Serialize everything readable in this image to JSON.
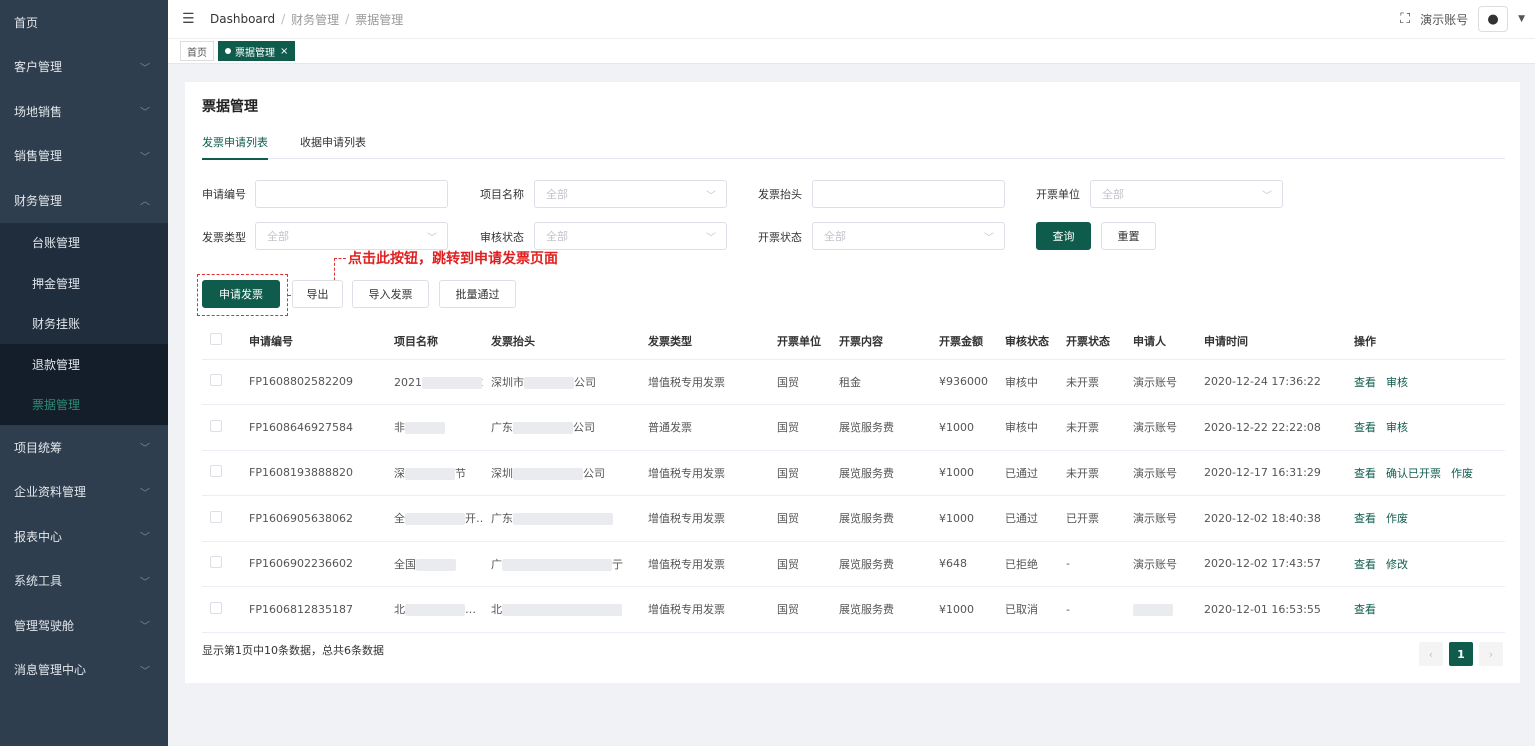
{
  "sidebar": {
    "items": [
      {
        "label": "首页",
        "chev": ""
      },
      {
        "label": "客户管理",
        "chev": "﹀"
      },
      {
        "label": "场地销售",
        "chev": "﹀"
      },
      {
        "label": "销售管理",
        "chev": "﹀"
      },
      {
        "label": "财务管理",
        "chev": "︿"
      }
    ],
    "submenu": [
      {
        "label": "台账管理"
      },
      {
        "label": "押金管理"
      },
      {
        "label": "财务挂账"
      },
      {
        "label": "退款管理"
      },
      {
        "label": "票据管理"
      }
    ],
    "items_after": [
      {
        "label": "项目统筹",
        "chev": "﹀"
      },
      {
        "label": "企业资料管理",
        "chev": "﹀"
      },
      {
        "label": "报表中心",
        "chev": "﹀"
      },
      {
        "label": "系统工具",
        "chev": "﹀"
      },
      {
        "label": "管理驾驶舱",
        "chev": "﹀"
      },
      {
        "label": "消息管理中心",
        "chev": "﹀"
      }
    ]
  },
  "header": {
    "breadcrumb": [
      "Dashboard",
      "财务管理",
      "票据管理"
    ],
    "account": "演示账号"
  },
  "tagsbar": {
    "home": "首页",
    "active": "票据管理",
    "close": "×"
  },
  "page": {
    "title": "票据管理",
    "tabs": [
      "发票申请列表",
      "收据申请列表"
    ]
  },
  "filters": {
    "apply_no": {
      "label": "申请编号",
      "value": ""
    },
    "project": {
      "label": "项目名称",
      "placeholder": "全部"
    },
    "invoice_title": {
      "label": "发票抬头",
      "value": ""
    },
    "issuer": {
      "label": "开票单位",
      "placeholder": "全部"
    },
    "invoice_type": {
      "label": "发票类型",
      "placeholder": "全部"
    },
    "review_status": {
      "label": "审核状态",
      "placeholder": "全部"
    },
    "issue_status": {
      "label": "开票状态",
      "placeholder": "全部"
    },
    "query": "查询",
    "reset": "重置"
  },
  "actions": {
    "apply": "申请发票",
    "export": "导出",
    "import": "导入发票",
    "batch": "批量通过"
  },
  "annotation": "点击此按钮，跳转到申请发票页面",
  "table": {
    "headers": [
      "申请编号",
      "项目名称",
      "发票抬头",
      "发票类型",
      "开票单位",
      "开票内容",
      "开票金额",
      "审核状态",
      "开票状态",
      "申请人",
      "申请时间",
      "操作"
    ],
    "rows": [
      {
        "no": "FP1608802582209",
        "project": "2021",
        "project_tail": "端…",
        "title": "深圳市",
        "title_tail": "公司",
        "type": "增值税专用发票",
        "issuer": "国贸",
        "content": "租金",
        "amount": "¥936000",
        "review": "审核中",
        "issue": "未开票",
        "applicant": "演示账号",
        "time": "2020-12-24 17:36:22",
        "ops": [
          "查看",
          "审核"
        ]
      },
      {
        "no": "FP1608646927584",
        "project": "非",
        "project_tail": "",
        "title": "广东",
        "title_tail": "公司",
        "type": "普通发票",
        "issuer": "国贸",
        "content": "展览服务费",
        "amount": "¥1000",
        "review": "审核中",
        "issue": "未开票",
        "applicant": "演示账号",
        "time": "2020-12-22 22:22:08",
        "ops": [
          "查看",
          "审核"
        ]
      },
      {
        "no": "FP1608193888820",
        "project": "深",
        "project_tail": "节",
        "title": "深圳",
        "title_tail": "公司",
        "type": "增值税专用发票",
        "issuer": "国贸",
        "content": "展览服务费",
        "amount": "¥1000",
        "review": "已通过",
        "issue": "未开票",
        "applicant": "演示账号",
        "time": "2020-12-17 16:31:29",
        "ops": [
          "查看",
          "确认已开票",
          "作废"
        ]
      },
      {
        "no": "FP1606905638062",
        "project": "全",
        "project_tail": "开…",
        "title": "广东",
        "title_tail": "",
        "type": "增值税专用发票",
        "issuer": "国贸",
        "content": "展览服务费",
        "amount": "¥1000",
        "review": "已通过",
        "issue": "已开票",
        "applicant": "演示账号",
        "time": "2020-12-02 18:40:38",
        "ops": [
          "查看",
          "作废"
        ]
      },
      {
        "no": "FP1606902236602",
        "project": "全国",
        "project_tail": "",
        "title": "广",
        "title_tail": "亍",
        "type": "增值税专用发票",
        "issuer": "国贸",
        "content": "展览服务费",
        "amount": "¥648",
        "review": "已拒绝",
        "issue": "-",
        "applicant": "演示账号",
        "time": "2020-12-02 17:43:57",
        "ops": [
          "查看",
          "修改"
        ]
      },
      {
        "no": "FP1606812835187",
        "project": "北",
        "project_tail": "…",
        "title": "北",
        "title_tail": "",
        "type": "增值税专用发票",
        "issuer": "国贸",
        "content": "展览服务费",
        "amount": "¥1000",
        "review": "已取消",
        "issue": "-",
        "applicant": "",
        "time": "2020-12-01 16:53:55",
        "ops": [
          "查看"
        ]
      }
    ]
  },
  "pager": {
    "summary": "显示第1页中10条数据，总共6条数据",
    "prev": "‹",
    "current": "1",
    "next": "›"
  },
  "colors": {
    "accent": "#0f5c4d",
    "sidebar": "#2f3e4e",
    "annotation": "#e02020"
  }
}
